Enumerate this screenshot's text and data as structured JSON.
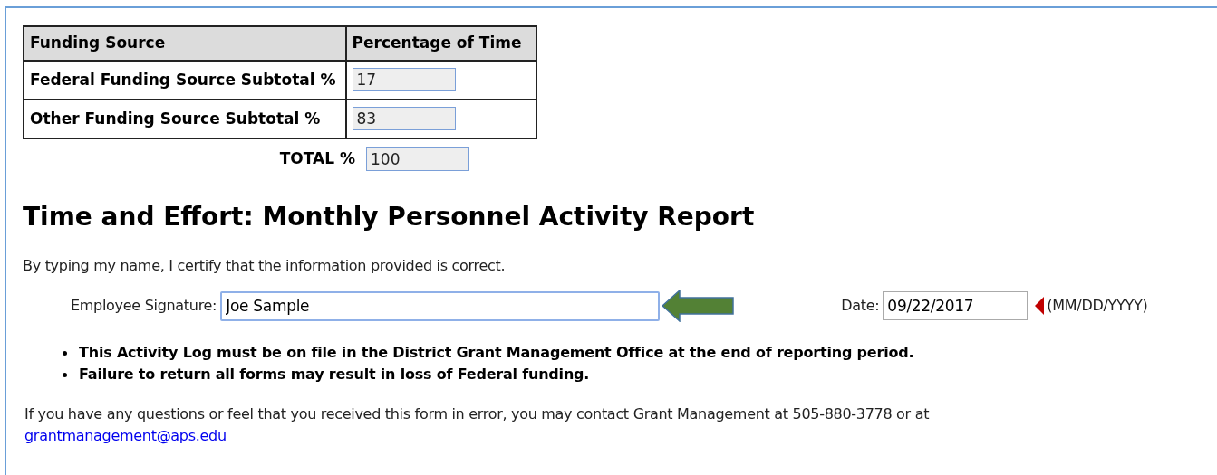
{
  "funding_table": {
    "columns": [
      "Funding Source",
      "Percentage of Time"
    ],
    "rows": [
      {
        "label": "Federal Funding Source Subtotal %",
        "value": "17"
      },
      {
        "label": "Other Funding Source Subtotal %",
        "value": "83"
      }
    ],
    "total": {
      "label": "TOTAL %",
      "value": "100"
    }
  },
  "title": "Time and Effort: Monthly Personnel Activity Report",
  "certify_text": "By typing my name, I certify that the information provided is correct.",
  "signature": {
    "label": "Employee Signature:",
    "value": "Joe Sample"
  },
  "date": {
    "label": "Date:",
    "value": "09/22/2017",
    "format": "(MM/DD/YYYY)"
  },
  "notes": [
    "This Activity Log must be on file in the District Grant Management Office at the end of reporting period.",
    "Failure to return all forms may result in loss of Federal funding."
  ],
  "contact": {
    "text": "If you have any questions or feel that you received this form in error, you may contact Grant Management at 505-880-3778 or at",
    "link": "grantmanagement@aps.edu"
  }
}
